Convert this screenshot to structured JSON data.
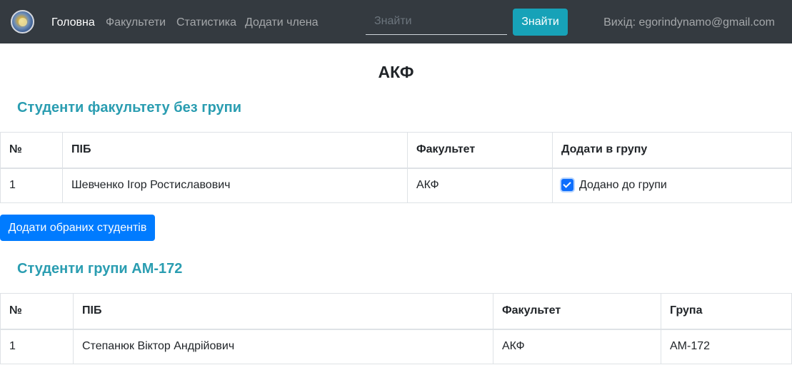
{
  "navbar": {
    "links": [
      {
        "label": "Головна",
        "active": true
      },
      {
        "label": "Факультети",
        "active": false
      },
      {
        "label": "Статистика",
        "active": false
      },
      {
        "label": "Додати члена",
        "active": false
      }
    ],
    "search_placeholder": "Знайти",
    "search_button": "Знайти",
    "logout": "Вихід: egorindynamo@gmail.com",
    "logo_icon": "university-emblem-icon"
  },
  "page_title": "АКФ",
  "ungrouped_section": {
    "title": "Студенти факультету без групи",
    "headers": [
      "№",
      "ПІБ",
      "Факультет",
      "Додати в групу"
    ],
    "rows": [
      {
        "num": "1",
        "name": "Шевченко Ігор Ростиславович",
        "faculty": "АКФ",
        "checkbox_label": "Додано до групи",
        "checked": true
      }
    ],
    "add_button": "Додати обраних студентів"
  },
  "group_section": {
    "title": "Студенти групи АМ-172",
    "headers": [
      "№",
      "ПІБ",
      "Факультет",
      "Група"
    ],
    "rows": [
      {
        "num": "1",
        "name": "Степанюк Віктор Андрійович",
        "faculty": "АКФ",
        "group": "АМ-172"
      }
    ]
  },
  "colors": {
    "navbar_bg": "#343a40",
    "accent_teal": "#17a2b8",
    "primary_blue": "#007bff",
    "section_title": "#2a9db1"
  }
}
